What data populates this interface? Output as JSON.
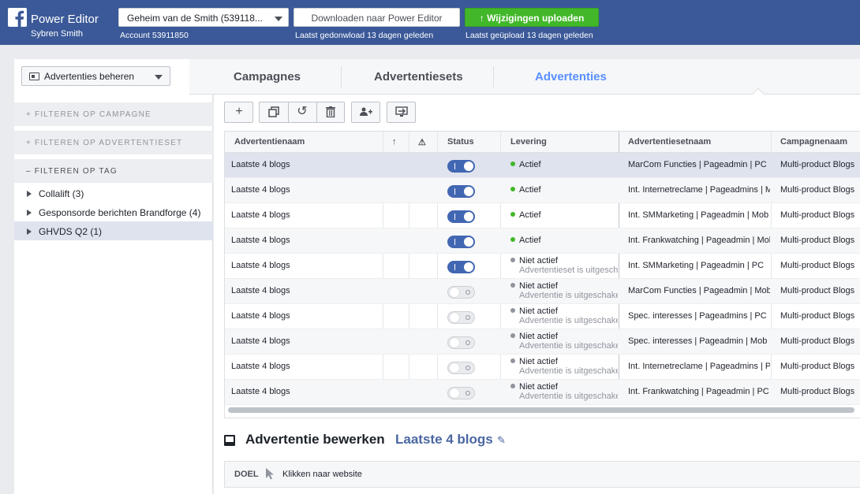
{
  "header": {
    "app_title": "Power Editor",
    "user_name": "Sybren Smith",
    "account_select": "Geheim van de Smith (539118...",
    "account_sub": "Account 53911850",
    "download_label": "Downloaden naar Power Editor",
    "download_sub": "Laatst gedonwload 13 dagen geleden",
    "upload_label": "Wijzigingen uploaden",
    "upload_sub": "Laatst geüpload 13 dagen geleden"
  },
  "sidebar": {
    "manage_label": "Advertenties beheren",
    "filter_campaign": "+ FILTEREN OP CAMPAGNE",
    "filter_adset": "+ FILTEREN OP ADVERTENTIESET",
    "filter_tag": "– FILTEREN OP TAG",
    "tags": [
      "Collalift (3)",
      "Gesponsorde berichten Brandforge (4)",
      "GHVDS Q2 (1)"
    ]
  },
  "tabs": [
    "Campagnes",
    "Advertentiesets",
    "Advertenties"
  ],
  "table": {
    "headers": {
      "name": "Advertentienaam",
      "status": "Status",
      "delivery": "Levering",
      "adset": "Advertentiesetnaam",
      "campaign": "Campagnenaam"
    },
    "rows": [
      {
        "name": "Laatste 4 blogs",
        "on": true,
        "delivery": "Actief",
        "sub": "",
        "adset": "MarCom Functies | Pageadmin | PC",
        "campaign": "Multi-product Blogs"
      },
      {
        "name": "Laatste 4 blogs",
        "on": true,
        "delivery": "Actief",
        "sub": "",
        "adset": "Int. Internetreclame | Pageadmins | M",
        "campaign": "Multi-product Blogs"
      },
      {
        "name": "Laatste 4 blogs",
        "on": true,
        "delivery": "Actief",
        "sub": "",
        "adset": "Int. SMMarketing | Pageadmin | Mob",
        "campaign": "Multi-product Blogs"
      },
      {
        "name": "Laatste 4 blogs",
        "on": true,
        "delivery": "Actief",
        "sub": "",
        "adset": "Int. Frankwatching | Pageadmin | Mob",
        "campaign": "Multi-product Blogs"
      },
      {
        "name": "Laatste 4 blogs",
        "on": true,
        "delivery": "Niet actief",
        "sub": "Advertentieset is uitgesch",
        "adset": "Int. SMMarketing | Pageadmin | PC",
        "campaign": "Multi-product Blogs"
      },
      {
        "name": "Laatste 4 blogs",
        "on": false,
        "delivery": "Niet actief",
        "sub": "Advertentie is uitgeschake",
        "adset": "MarCom Functies | Pageadmin | Mob",
        "campaign": "Multi-product Blogs"
      },
      {
        "name": "Laatste 4 blogs",
        "on": false,
        "delivery": "Niet actief",
        "sub": "Advertentie is uitgeschake",
        "adset": "Spec. interesses | Pageadmins | PC",
        "campaign": "Multi-product Blogs"
      },
      {
        "name": "Laatste 4 blogs",
        "on": false,
        "delivery": "Niet actief",
        "sub": "Advertentie is uitgeschake",
        "adset": "Spec. interesses | Pageadmin | Mob",
        "campaign": "Multi-product Blogs"
      },
      {
        "name": "Laatste 4 blogs",
        "on": false,
        "delivery": "Niet actief",
        "sub": "Advertentie is uitgeschake",
        "adset": "Int. Internetreclame | Pageadmins | P",
        "campaign": "Multi-product Blogs"
      },
      {
        "name": "Laatste 4 blogs",
        "on": false,
        "delivery": "Niet actief",
        "sub": "Advertentie is uitgeschake",
        "adset": "Int. Frankwatching | Pageadmin | PC",
        "campaign": "Multi-product Blogs"
      }
    ]
  },
  "editor": {
    "title": "Advertentie bewerken",
    "name": "Laatste 4 blogs",
    "doel_label": "DOEL",
    "doel_value": "Klikken naar website"
  }
}
